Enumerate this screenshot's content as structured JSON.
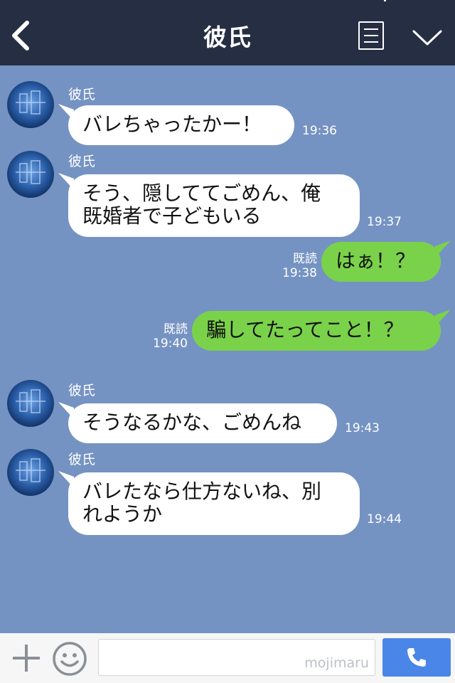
{
  "header": {
    "title": "彼氏",
    "back_icon": "chevron-left-icon",
    "menu_icon": "list-menu-icon",
    "collapse_icon": "chevron-down-icon"
  },
  "messages": [
    {
      "side": "in",
      "sender": "彼氏",
      "text": "バレちゃったかー！",
      "time": "19:36"
    },
    {
      "side": "in",
      "sender": "彼氏",
      "text": "そう、隠しててごめん、俺\n既婚者で子どもいる",
      "time": "19:37"
    },
    {
      "side": "out",
      "read": "既読",
      "text": "はぁ！？",
      "time": "19:38"
    },
    {
      "side": "out",
      "read": "既読",
      "text": "騙してたってこと！？",
      "time": "19:40"
    },
    {
      "side": "in",
      "sender": "彼氏",
      "text": "そうなるかな、ごめんね",
      "time": "19:43"
    },
    {
      "side": "in",
      "sender": "彼氏",
      "text": "バレたなら仕方ないね、別\nれようか",
      "time": "19:44"
    }
  ],
  "footer": {
    "plus_icon": "plus-icon",
    "emoji_icon": "smiley-icon",
    "input_placeholder": "",
    "watermark": "mojimaru",
    "send_icon": "phone-icon"
  },
  "colors": {
    "header_bg": "#252e43",
    "chat_bg": "#7593c2",
    "outgoing_bubble": "#7ad24a",
    "incoming_bubble": "#ffffff",
    "send_button": "#4a86e8"
  }
}
